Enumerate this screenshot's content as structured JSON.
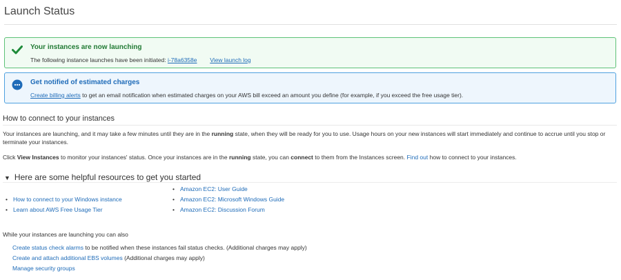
{
  "page": {
    "title": "Launch Status"
  },
  "success_alert": {
    "heading": "Your instances are now launching",
    "body_prefix": "The following instance launches have been initiated:",
    "instance_id": "i-78a6358e",
    "view_log": "View launch log",
    "color": "#5cc176"
  },
  "info_alert": {
    "heading": "Get notified of estimated charges",
    "billing_link": "Create billing alerts",
    "body_suffix": "to get an email notification when estimated charges on your AWS bill exceed an amount you define (for example, if you exceed the free usage tier).",
    "color": "#4da0df"
  },
  "connect": {
    "title": "How to connect to your instances",
    "p1_a": "Your instances are launching, and it may take a few minutes until they are in the",
    "p1_b": "running",
    "p1_c": "state, when they will be ready for you to use. Usage hours on your new instances will start immediately and continue to accrue until you stop or terminate your instances.",
    "p2_a": "Click",
    "p2_b": "View Instances",
    "p2_c": "to monitor your instances' status. Once your instances are in the",
    "p2_d": "running",
    "p2_e": "state, you can",
    "p2_f": "connect",
    "p2_g": "to them from the Instances screen.",
    "p2_link": "Find out",
    "p2_h": "how to connect to your instances."
  },
  "resources": {
    "title": "Here are some helpful resources to get you started",
    "left": [
      "How to connect to your Windows instance",
      "Learn about AWS Free Usage Tier"
    ],
    "right": [
      "Amazon EC2: User Guide",
      "Amazon EC2: Microsoft Windows Guide",
      "Amazon EC2: Discussion Forum"
    ]
  },
  "also": {
    "intro": "While your instances are launching you can also",
    "a1_link": "Create status check alarms",
    "a1_text": "to be notified when these instances fail status checks. (Additional charges may apply)",
    "a2_link": "Create and attach additional EBS volumes",
    "a2_text": "(Additional charges may apply)",
    "a3_link": "Manage security groups"
  }
}
